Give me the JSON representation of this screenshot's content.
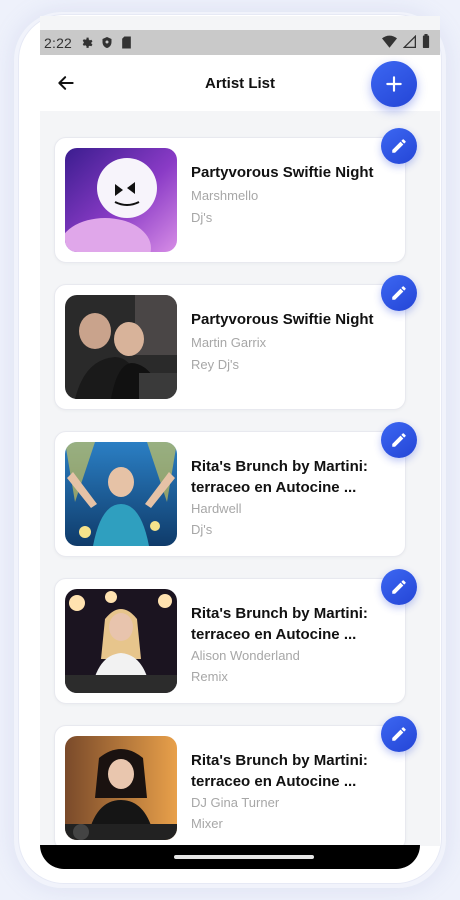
{
  "status_bar": {
    "time": "2:22"
  },
  "app_bar": {
    "title": "Artist List",
    "back_icon": "arrow-left-icon",
    "add_icon": "plus-icon"
  },
  "colors": {
    "accent": "#2f55e8",
    "title": "#111111",
    "subtitle": "#a7a7a7"
  },
  "artists": [
    {
      "event": "Partyvorous Swiftie Night",
      "artist": "Marshmello",
      "genre": "Dj's"
    },
    {
      "event": "Partyvorous Swiftie Night",
      "artist": "Martin Garrix",
      "genre": "Rey Dj's"
    },
    {
      "event": "Rita's Brunch by Martini: terraceo en Autocine ...",
      "artist": "Hardwell",
      "genre": "Dj's"
    },
    {
      "event": "Rita's Brunch by Martini: terraceo en Autocine ...",
      "artist": "Alison Wonderland",
      "genre": "Remix"
    },
    {
      "event": "Rita's Brunch by Martini: terraceo en Autocine ...",
      "artist": "DJ Gina Turner",
      "genre": "Mixer"
    }
  ]
}
